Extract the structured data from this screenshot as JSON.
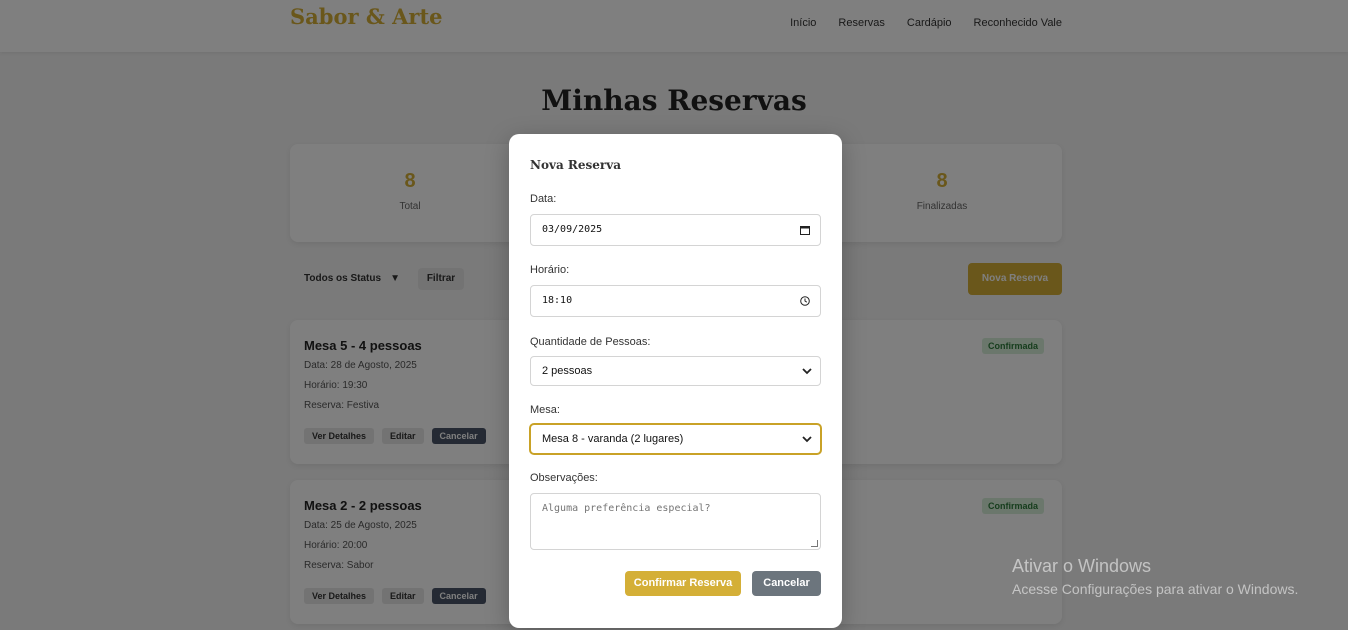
{
  "header": {
    "brand": "Sabor & Arte",
    "nav": [
      "Início",
      "Reservas",
      "Cardápio",
      "Reconhecido Vale"
    ]
  },
  "page_title": "Minhas Reservas",
  "stats": [
    {
      "value": "8",
      "label": "Total"
    },
    {
      "value": "8",
      "label": "Finalizadas"
    }
  ],
  "filters": {
    "status_select": "Todos os Status",
    "filter_button": "Filtrar",
    "new_button": "Nova Reserva"
  },
  "cards": [
    {
      "title": "Mesa 5 - 4 pessoas",
      "date": "Data: 28 de Agosto, 2025",
      "time": "Horário: 19:30",
      "obs": "Reserva: Festiva",
      "badge": "Confirmada",
      "actions": [
        "Ver Detalhes",
        "Editar",
        "Cancelar"
      ]
    },
    {
      "title": "Mesa 2 - 2 pessoas",
      "date": "Data: 25 de Agosto, 2025",
      "time": "Horário: 20:00",
      "obs": "Reserva: Sabor",
      "badge": "Confirmada",
      "actions": [
        "Ver Detalhes",
        "Editar",
        "Cancelar"
      ]
    }
  ],
  "modal": {
    "title": "Nova Reserva",
    "date_label": "Data:",
    "date_value": "03/09/2025",
    "time_label": "Horário:",
    "time_value": "18:10",
    "people_label": "Quantidade de Pessoas:",
    "people_value": "2 pessoas",
    "table_label": "Mesa:",
    "table_value": "Mesa 8 - varanda (2 lugares)",
    "notes_label": "Observações:",
    "notes_placeholder": "Alguma preferência especial?",
    "confirm_label": "Confirmar Reserva",
    "cancel_label": "Cancelar"
  },
  "watermark": {
    "title": "Ativar o Windows",
    "subtitle": "Acesse Configurações para ativar o Windows."
  },
  "colors": {
    "accent": "#d4af37",
    "cancel": "#6c757d",
    "overlay": "rgba(0,0,0,0.5)"
  }
}
